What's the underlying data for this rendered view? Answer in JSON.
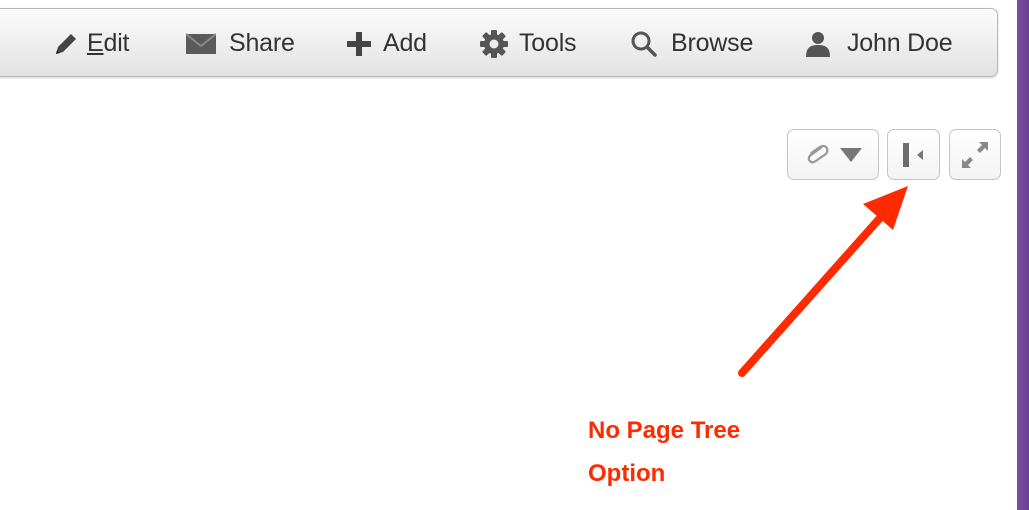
{
  "toolbar": {
    "items": [
      {
        "label": "Edit",
        "icon": "pencil-icon"
      },
      {
        "label": "Share",
        "icon": "envelope-icon"
      },
      {
        "label": "Add",
        "icon": "plus-icon"
      },
      {
        "label": "Tools",
        "icon": "gear-icon"
      },
      {
        "label": "Browse",
        "icon": "search-icon"
      },
      {
        "label": "John Doe",
        "icon": "user-icon"
      }
    ]
  },
  "page_tools": [
    {
      "icon": "paperclip-icon"
    },
    {
      "icon": "sidebar-collapse-icon"
    },
    {
      "icon": "expand-icon"
    }
  ],
  "annotation": {
    "line1": "No Page Tree",
    "line2": "Option",
    "color": "#ff2a00"
  },
  "colors": {
    "accent_purple": "#6b3f93",
    "icon_gray": "#444444",
    "text": "#333333"
  }
}
